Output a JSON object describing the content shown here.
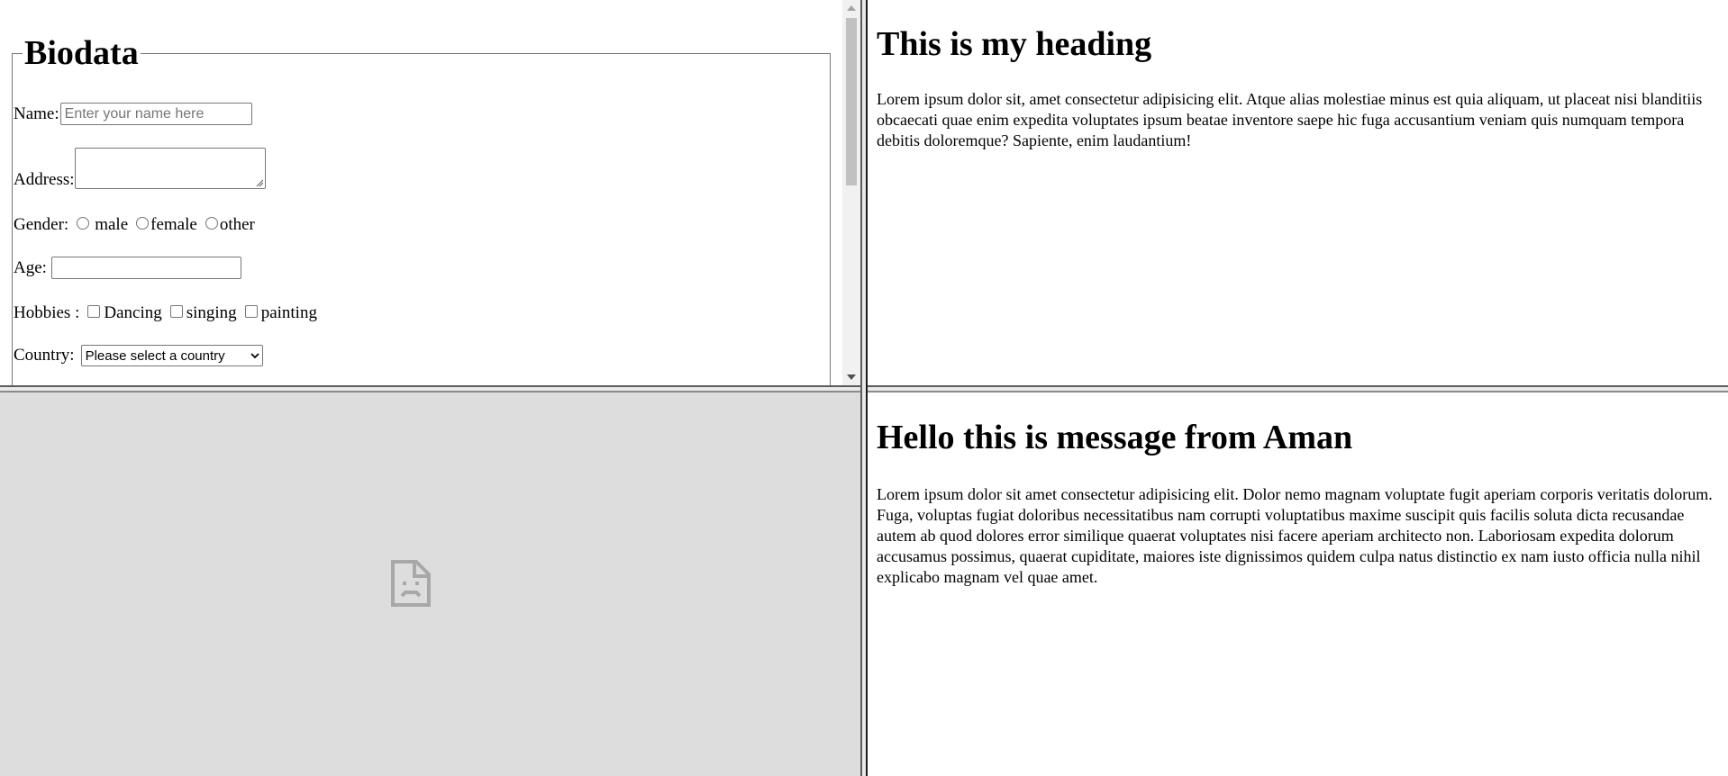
{
  "form": {
    "legend": "Biodata",
    "name_label": "Name:",
    "name_placeholder": "Enter your name here",
    "address_label": "Address:",
    "gender_label": "Gender:",
    "gender_options": [
      "male",
      "female",
      "other"
    ],
    "age_label": "Age:",
    "hobbies_label": "Hobbies :",
    "hobby_options": [
      "Dancing",
      "singing",
      "painting"
    ],
    "country_label": "Country:",
    "country_selected": "Please select a country"
  },
  "top_right": {
    "heading": "This is my heading",
    "paragraph": "Lorem ipsum dolor sit, amet consectetur adipisicing elit. Atque alias molestiae minus est quia aliquam, ut placeat nisi blanditiis obcaecati quae enim expedita voluptates ipsum beatae inventore saepe hic fuga accusantium veniam quis numquam tempora debitis doloremque? Sapiente, enim laudantium!"
  },
  "bottom_right": {
    "heading": "Hello this is message from Aman",
    "paragraph": "Lorem ipsum dolor sit amet consectetur adipisicing elit. Dolor nemo magnam voluptate fugit aperiam corporis veritatis dolorum. Fuga, voluptas fugiat doloribus necessitatibus nam corrupti voluptatibus maxime suscipit quis facilis soluta dicta recusandae autem ab quod dolores error similique quaerat voluptates nisi facere aperiam architecto non. Laboriosam expedita dolorum accusamus possimus, quaerat cupiditate, maiores iste dignissimos quidem culpa natus distinctio ex nam iusto officia nulla nihil explicabo magnam vel quae amet."
  },
  "bottom_left": {
    "icon": "broken-document-icon"
  },
  "colors": {
    "frame_border": "#e9e9e9",
    "error_background": "#dddddd",
    "icon_color": "#a8a8a8"
  }
}
